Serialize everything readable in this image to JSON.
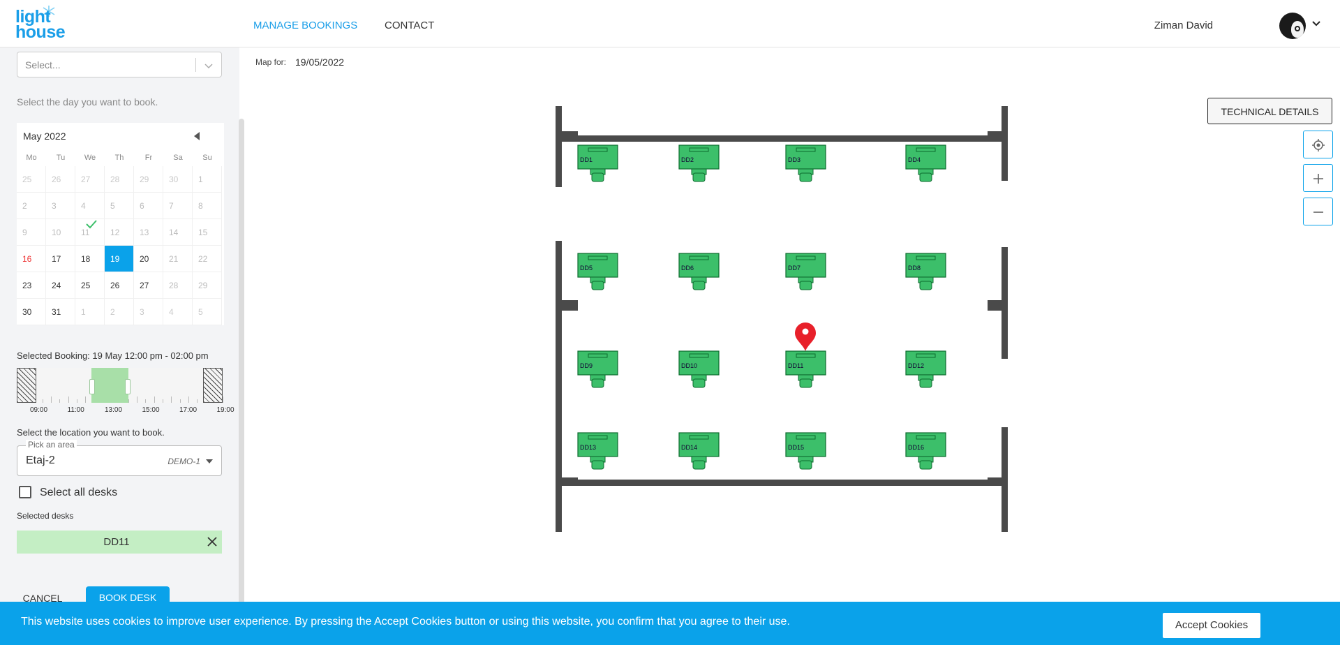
{
  "header": {
    "logo": {
      "line1": "light",
      "line2": "house"
    },
    "nav": {
      "manage": "MANAGE BOOKINGS",
      "contact": "CONTACT"
    },
    "user": {
      "name": "Ziman David"
    }
  },
  "sidebar": {
    "select_placeholder": "Select...",
    "day_help": "Select the day you want to book.",
    "calendar": {
      "title": "May 2022",
      "weekdays": [
        "Mo",
        "Tu",
        "We",
        "Th",
        "Fr",
        "Sa",
        "Su"
      ],
      "weeks": [
        [
          "25",
          "26",
          "27",
          "28",
          "29",
          "30",
          "1"
        ],
        [
          "2",
          "3",
          "4",
          "5",
          "6",
          "7",
          "8"
        ],
        [
          "9",
          "10",
          "11",
          "12",
          "13",
          "14",
          "15"
        ],
        [
          "16",
          "17",
          "18",
          "19",
          "20",
          "21",
          "22"
        ],
        [
          "23",
          "24",
          "25",
          "26",
          "27",
          "28",
          "29"
        ],
        [
          "30",
          "31",
          "1",
          "2",
          "3",
          "4",
          "5"
        ]
      ],
      "today": "16",
      "selected": "19",
      "booked": "11"
    },
    "booking_text": "Selected Booking: 19 May 12:00 pm - 02:00 pm",
    "time_labels": [
      "09:00",
      "11:00",
      "13:00",
      "15:00",
      "17:00",
      "19:00"
    ],
    "selected_range_hours": {
      "start": 12,
      "end": 14
    },
    "location_help": "Select the location you want to book.",
    "area": {
      "label": "Pick an area",
      "value": "Etaj-2",
      "tag": "DEMO-1"
    },
    "select_all_label": "Select all desks",
    "selected_desks_label": "Selected desks",
    "selected_desk": "DD11",
    "cancel_label": "CANCEL",
    "book_label": "BOOK DESK"
  },
  "map": {
    "label": "Map for:",
    "date": "19/05/2022",
    "tech_button": "TECHNICAL DETAILS",
    "controls": [
      "locate-icon",
      "zoom-in-icon",
      "zoom-out-icon"
    ],
    "desks": [
      [
        "DD1",
        "DD2",
        "DD3",
        "DD4"
      ],
      [
        "DD5",
        "DD6",
        "DD7",
        "DD8"
      ],
      [
        "DD9",
        "DD10",
        "DD11",
        "DD12"
      ],
      [
        "DD13",
        "DD14",
        "DD15",
        "DD16"
      ]
    ],
    "selected_desk": "DD11",
    "desk_color": "#3cbf6a",
    "pin_color": "#e8202a"
  },
  "cookie": {
    "message": "This website uses cookies to improve user experience. By pressing the Accept Cookies button or using this website, you confirm that you agree to their use.",
    "button": "Accept Cookies"
  }
}
